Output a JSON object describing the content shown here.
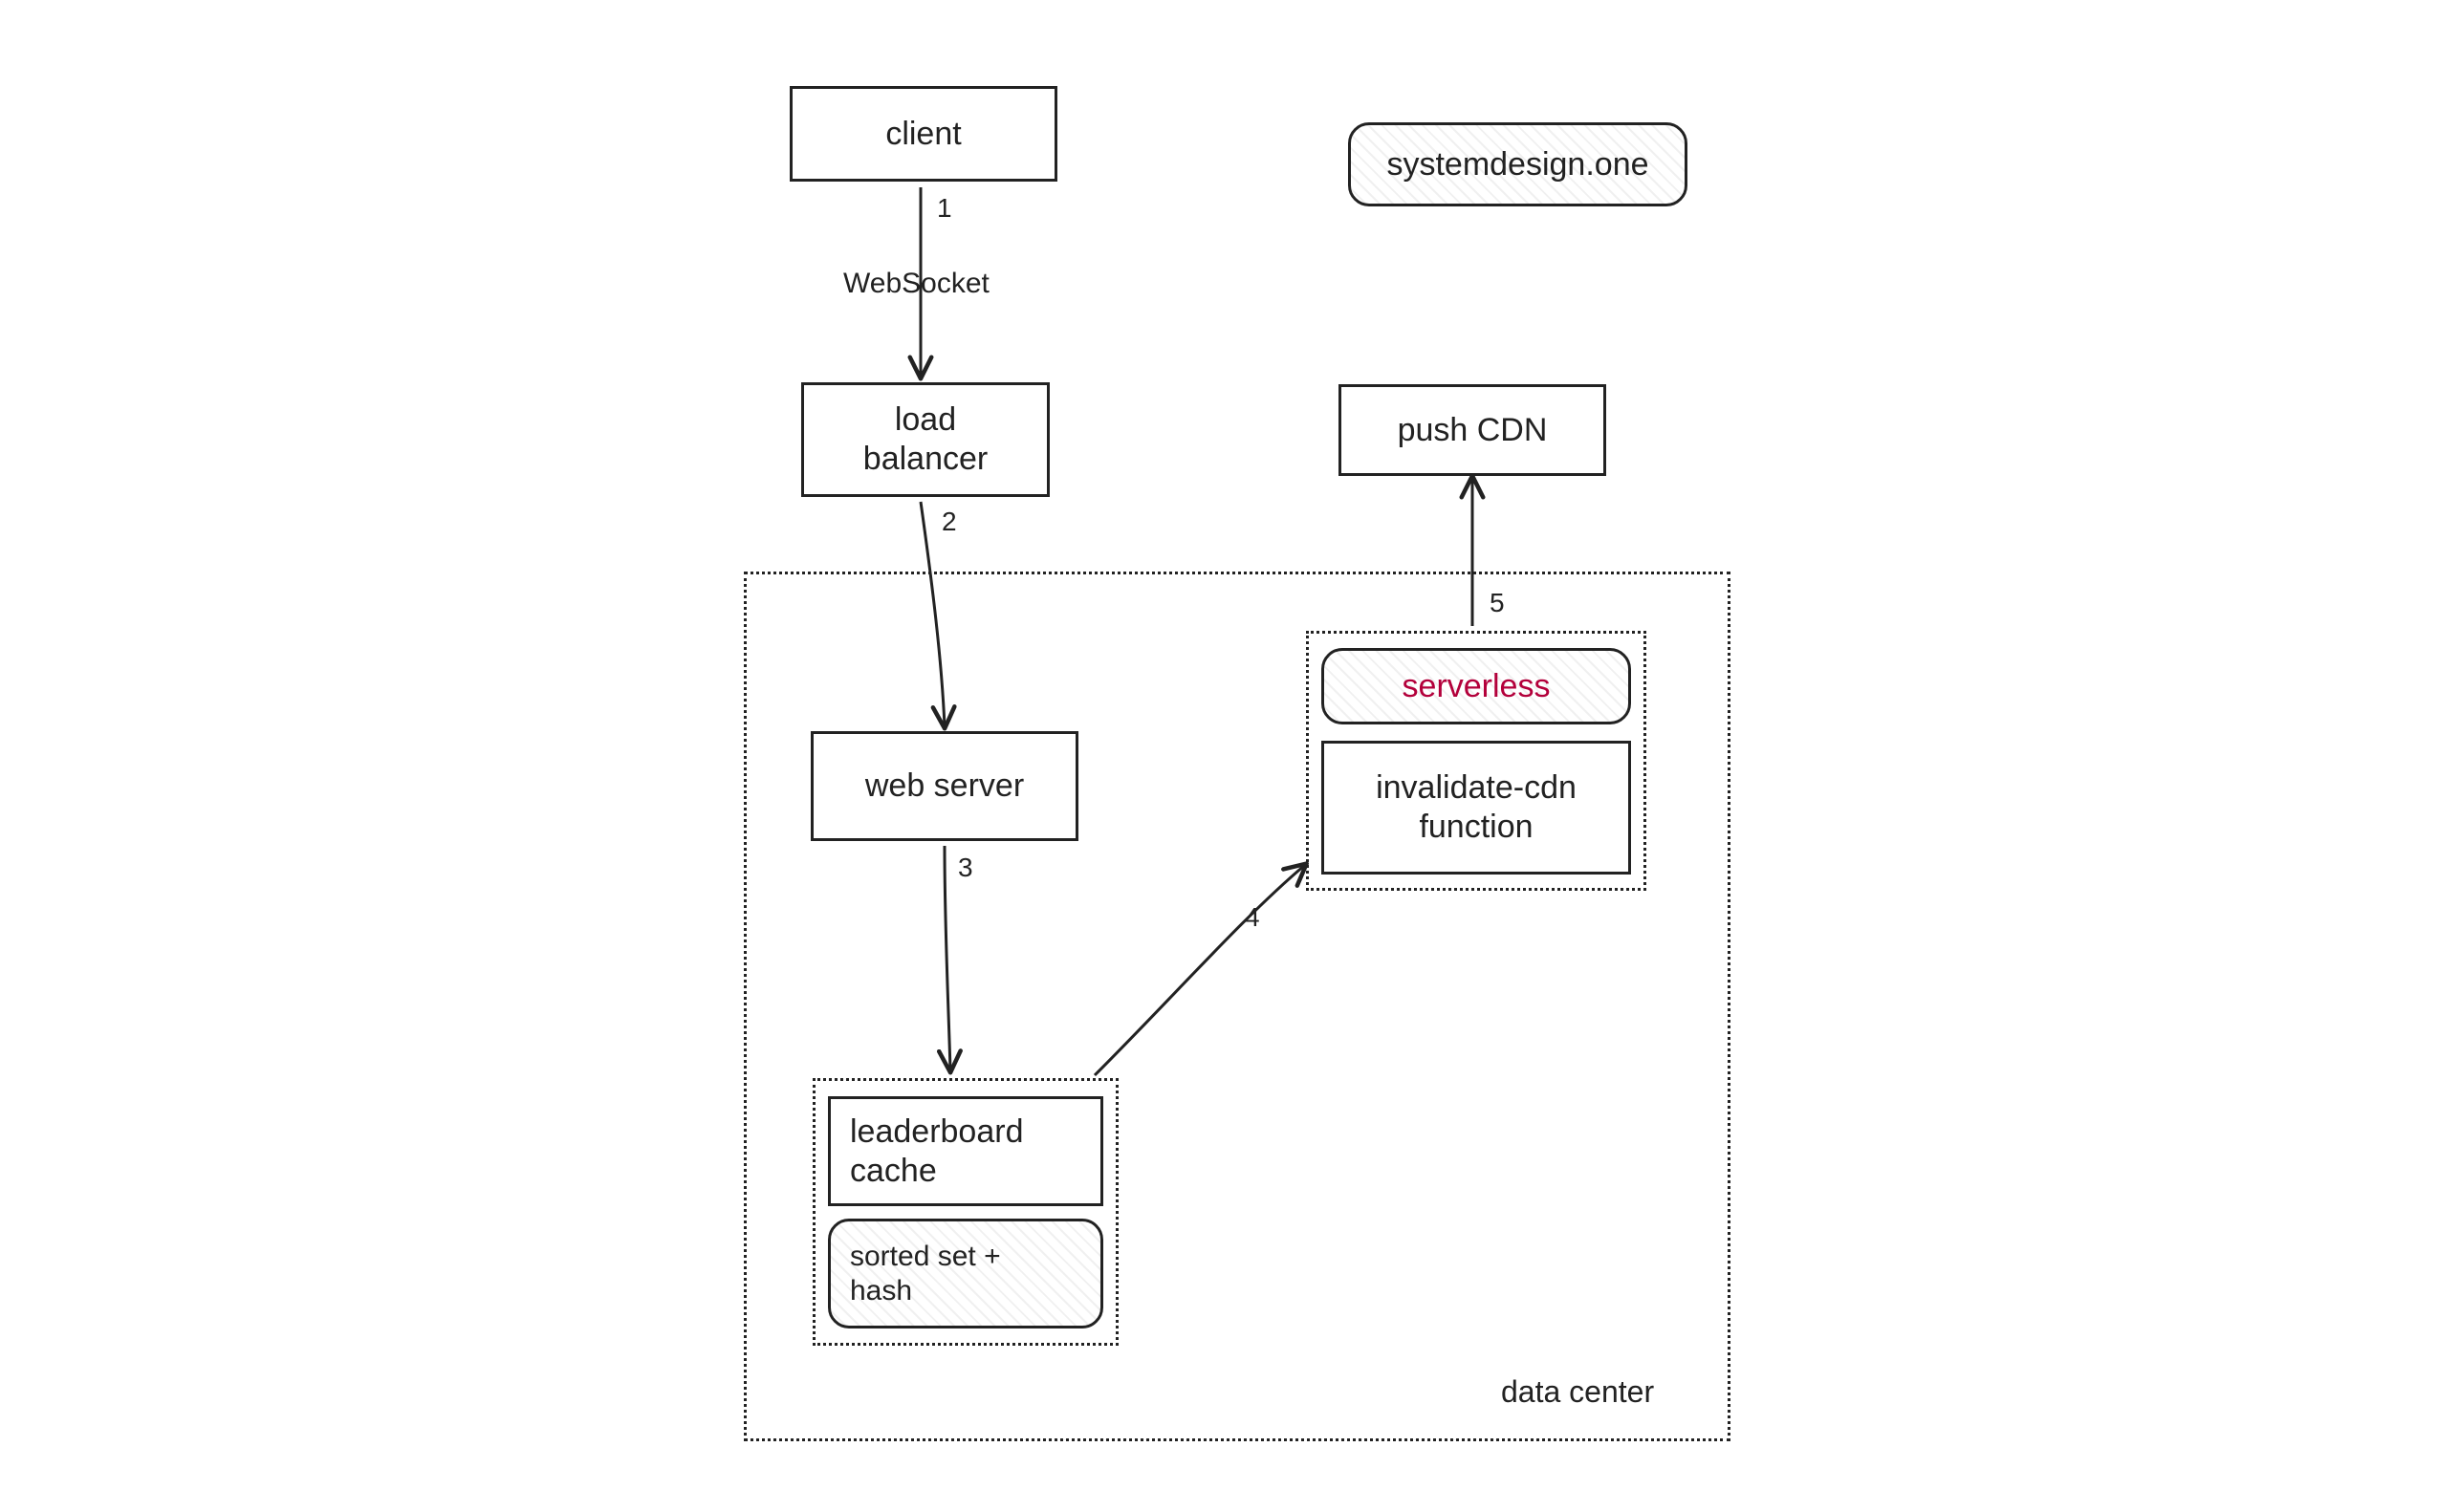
{
  "watermark": "systemdesign.one",
  "nodes": {
    "client": "client",
    "load_balancer": "load\nbalancer",
    "web_server": "web server",
    "leaderboard_cache": "leaderboard\ncache",
    "sorted_set_hash": "sorted set +\nhash",
    "serverless": "serverless",
    "invalidate_fn": "invalidate-cdn\nfunction",
    "push_cdn": "push CDN"
  },
  "edges": {
    "e1": {
      "num": "1",
      "label": "WebSocket"
    },
    "e2": {
      "num": "2"
    },
    "e3": {
      "num": "3"
    },
    "e4": {
      "num": "4"
    },
    "e5": {
      "num": "5"
    }
  },
  "regions": {
    "data_center": "data center"
  }
}
